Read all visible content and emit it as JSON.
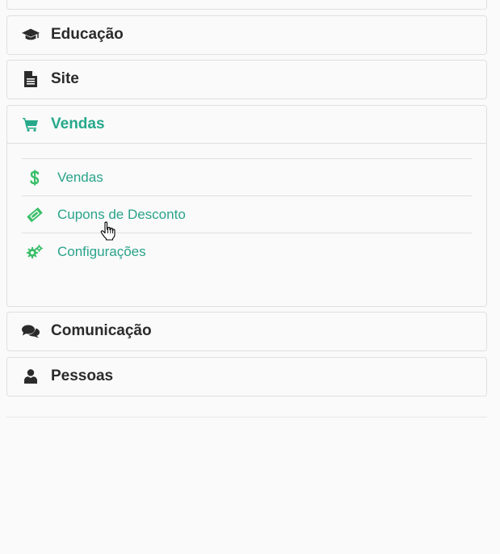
{
  "colors": {
    "accent": "#26a98b",
    "icon_dark": "#2b2b2b",
    "icon_green": "#3bbf6a"
  },
  "menu": {
    "educacao": {
      "label": "Educação",
      "icon": "graduation-cap-icon"
    },
    "site": {
      "label": "Site",
      "icon": "file-text-icon"
    },
    "vendas": {
      "label": "Vendas",
      "icon": "shopping-cart-icon",
      "expanded": true,
      "items": [
        {
          "label": "Vendas",
          "icon": "dollar-icon"
        },
        {
          "label": "Cupons de Desconto",
          "icon": "ticket-icon"
        },
        {
          "label": "Configurações",
          "icon": "gears-icon"
        }
      ]
    },
    "comunicacao": {
      "label": "Comunicação",
      "icon": "comments-icon"
    },
    "pessoas": {
      "label": "Pessoas",
      "icon": "user-icon"
    }
  }
}
